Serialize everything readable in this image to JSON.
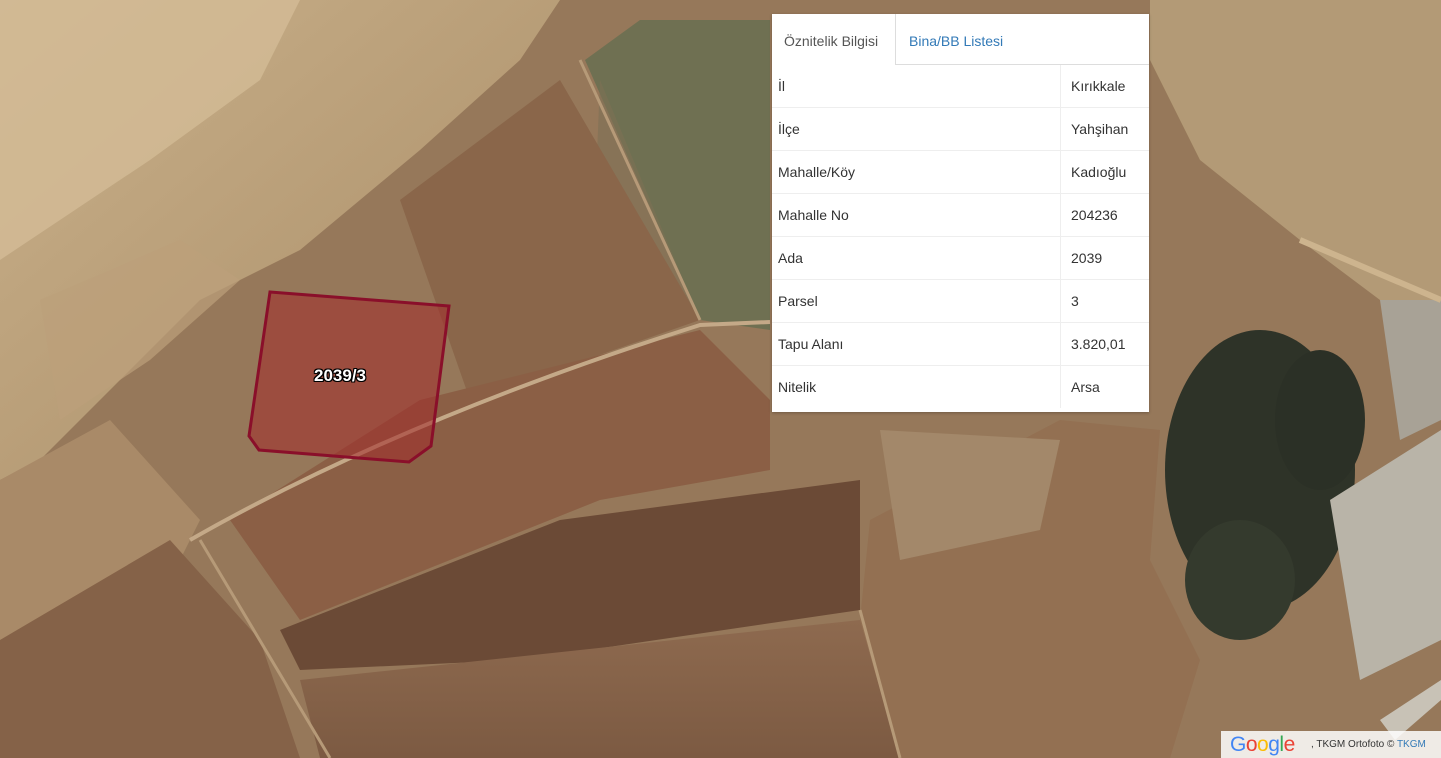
{
  "parcel": {
    "label": "2039/3",
    "stroke_color": "#8a0f2a",
    "fill_color": "#a32a2a"
  },
  "panel": {
    "tabs": [
      {
        "label": "Öznitelik Bilgisi",
        "active": true
      },
      {
        "label": "Bina/BB Listesi",
        "active": false
      }
    ],
    "rows": [
      {
        "key": "İl",
        "value": "Kırıkkale"
      },
      {
        "key": "İlçe",
        "value": "Yahşihan"
      },
      {
        "key": "Mahalle/Köy",
        "value": "Kadıoğlu"
      },
      {
        "key": "Mahalle No",
        "value": "204236"
      },
      {
        "key": "Ada",
        "value": "2039"
      },
      {
        "key": "Parsel",
        "value": "3"
      },
      {
        "key": "Tapu Alanı",
        "value": "3.820,01"
      },
      {
        "key": "Nitelik",
        "value": "Arsa"
      }
    ]
  },
  "attribution": {
    "logo": [
      "G",
      "o",
      "o",
      "g",
      "l",
      "e"
    ],
    "logo_colors": [
      "#4285f4",
      "#ea4335",
      "#fbbc05",
      "#4285f4",
      "#34a853",
      "#ea4335"
    ],
    "text": ", TKGM Ortofoto ©",
    "link": "TKGM"
  }
}
